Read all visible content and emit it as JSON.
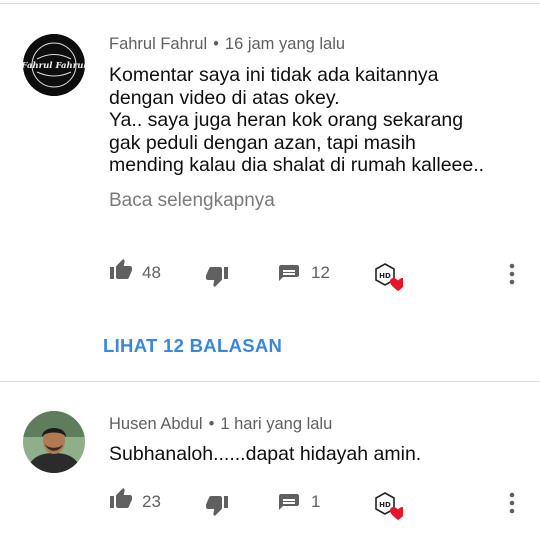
{
  "comments": [
    {
      "author": "Fahrul Fahrul",
      "separator": "•",
      "time": "16 jam yang lalu",
      "avatar_text": "Fahrul Fahrul",
      "lines": [
        "Komentar saya ini tidak ada kaitannya",
        "dengan video di atas okey.",
        "Ya.. saya juga heran kok orang sekarang",
        "gak peduli dengan azan, tapi masih",
        "mending kalau dia shalat di rumah kalleee.."
      ],
      "read_more": "Baca selengkapnya",
      "likes": "48",
      "replies_count": "12",
      "view_replies": "LIHAT 12 BALASAN"
    },
    {
      "author": "Husen Abdul",
      "separator": "•",
      "time": "1 hari yang lalu",
      "lines": [
        "Subhanaloh......dapat hidayah amin."
      ],
      "likes": "23",
      "replies_count": "1"
    }
  ],
  "icons": {
    "like": "thumb-up-icon",
    "dislike": "thumb-down-icon",
    "reply": "comment-icon",
    "creator_heart": "hd-heart-badge",
    "menu": "more-vert-icon"
  },
  "colors": {
    "link": "#3a86df",
    "meta": "#606060",
    "heart": "#e8152a",
    "icon": "#606060"
  }
}
